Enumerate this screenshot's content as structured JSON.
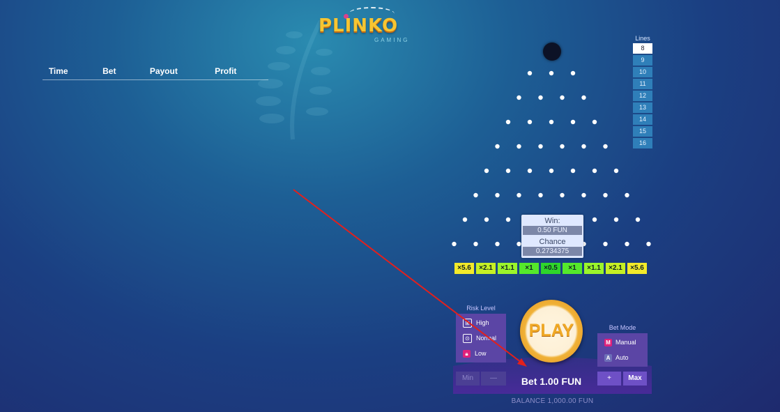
{
  "logo": {
    "title": "PLINKO",
    "subtitle": "GAMING"
  },
  "history": {
    "columns": [
      "Time",
      "Bet",
      "Payout",
      "Profit"
    ],
    "rows": []
  },
  "lines": {
    "title": "Lines",
    "options": [
      "8",
      "9",
      "10",
      "11",
      "12",
      "13",
      "14",
      "15",
      "16"
    ],
    "selected": "8"
  },
  "multipliers": [
    "×5.6",
    "×2.1",
    "×1.1",
    "×1",
    "×0.5",
    "×1",
    "×1.1",
    "×2.1",
    "×5.6"
  ],
  "multiplier_colors": [
    "#f3ea2a",
    "#c6f024",
    "#9bf52b",
    "#55e82b",
    "#2fd62b",
    "#55e82b",
    "#9bf52b",
    "#c6f024",
    "#f3ea2a"
  ],
  "tooltip": {
    "win_label": "Win:",
    "win_value": "0.50 FUN",
    "chance_label": "Chance",
    "chance_value": "0.2734375"
  },
  "risk": {
    "title": "Risk Level",
    "options": [
      "High",
      "Normal",
      "Low"
    ]
  },
  "mode": {
    "title": "Bet Mode",
    "options": [
      "Manual",
      "Auto"
    ],
    "manual_icon": "M",
    "auto_icon": "A"
  },
  "play": {
    "label": "PLAY"
  },
  "bet": {
    "label": "Bet 1.00 FUN",
    "min": "Min",
    "minus": "—",
    "plus": "+",
    "max": "Max"
  },
  "balance": "BALANCE 1,000.00 FUN",
  "colors": {
    "accent": "#f0a925",
    "panel": "#5b45a5",
    "background": "#1b3f82"
  }
}
